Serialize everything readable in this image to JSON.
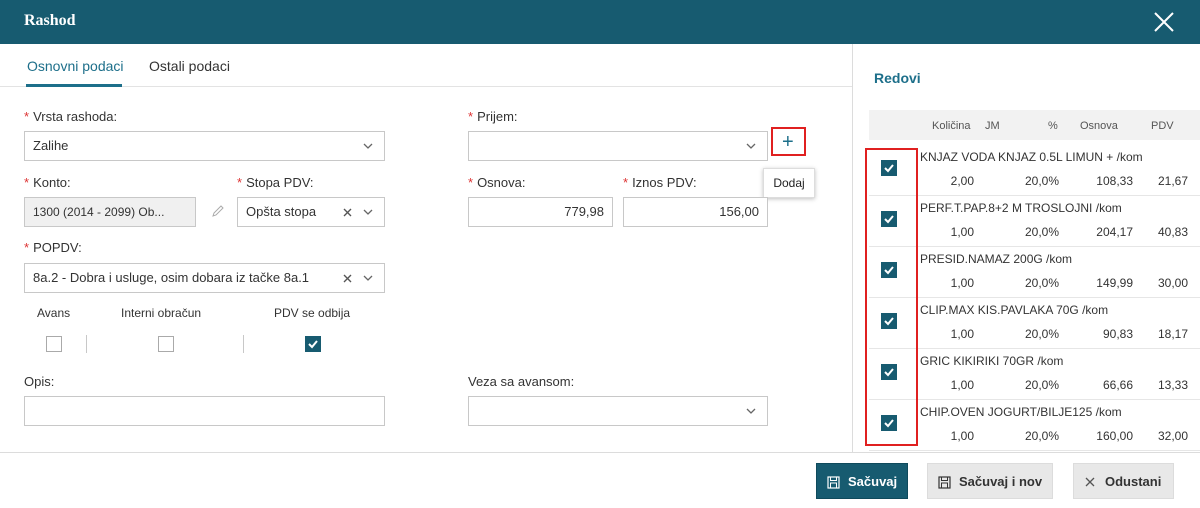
{
  "header": {
    "title": "Rashod",
    "ghost_left": "...",
    "ghost_right": "..."
  },
  "tabs": [
    {
      "label": "Osnovni podaci",
      "active": true
    },
    {
      "label": "Ostali podaci",
      "active": false
    }
  ],
  "form": {
    "required_mark": "*",
    "vrsta_rashoda": {
      "label": "Vrsta rashoda:",
      "value": "Zalihe"
    },
    "prijem": {
      "label": "Prijem:",
      "value": ""
    },
    "konto": {
      "label": "Konto:",
      "value": "1300 (2014 - 2099) Ob..."
    },
    "stopa_pdv": {
      "label": "Stopa PDV:",
      "value": "Opšta stopa"
    },
    "osnova": {
      "label": "Osnova:",
      "value": "779,98"
    },
    "iznos_pdv": {
      "label": "Iznos PDV:",
      "value": "156,00"
    },
    "popdv": {
      "label": "POPDV:",
      "value": "8a.2 - Dobra i usluge, osim dobara iz tačke 8a.1"
    },
    "avans": {
      "label": "Avans",
      "checked": false
    },
    "interni_obracun": {
      "label": "Interni obračun",
      "checked": false
    },
    "pdv_se_odbija": {
      "label": "PDV se odbija",
      "checked": true
    },
    "opis": {
      "label": "Opis:",
      "value": ""
    },
    "veza_sa_avansom": {
      "label": "Veza sa avansom:",
      "value": ""
    },
    "add_button": {
      "symbol": "+",
      "tooltip": "Dodaj"
    }
  },
  "redovi": {
    "title": "Redovi",
    "columns": [
      "Količina",
      "JM",
      "%",
      "Osnova",
      "PDV"
    ],
    "rows": [
      {
        "name": "KNJAZ VODA KNJAZ 0.5L LIMUN + /kom",
        "kolicina": "2,00",
        "procenat": "20,0%",
        "osnova": "108,33",
        "pdv": "21,67",
        "checked": true
      },
      {
        "name": "PERF.T.PAP.8+2 M TROSLOJNI /kom",
        "kolicina": "1,00",
        "procenat": "20,0%",
        "osnova": "204,17",
        "pdv": "40,83",
        "checked": true
      },
      {
        "name": "PRESID.NAMAZ 200G /kom",
        "kolicina": "1,00",
        "procenat": "20,0%",
        "osnova": "149,99",
        "pdv": "30,00",
        "checked": true
      },
      {
        "name": "CLIP.MAX KIS.PAVLAKA 70G /kom",
        "kolicina": "1,00",
        "procenat": "20,0%",
        "osnova": "90,83",
        "pdv": "18,17",
        "checked": true
      },
      {
        "name": "GRIC KIKIRIKI 70GR /kom",
        "kolicina": "1,00",
        "procenat": "20,0%",
        "osnova": "66,66",
        "pdv": "13,33",
        "checked": true
      },
      {
        "name": "CHIP.OVEN JOGURT/BILJE125 /kom",
        "kolicina": "1,00",
        "procenat": "20,0%",
        "osnova": "160,00",
        "pdv": "32,00",
        "checked": true
      }
    ]
  },
  "footer": {
    "save_label": "Sačuvaj",
    "save_new_label": "Sačuvaj i nov",
    "cancel_label": "Odustani"
  },
  "colors": {
    "header": "#175b70",
    "accent": "#1d6f8a",
    "highlight": "#e02020",
    "required": "#dd3333"
  }
}
